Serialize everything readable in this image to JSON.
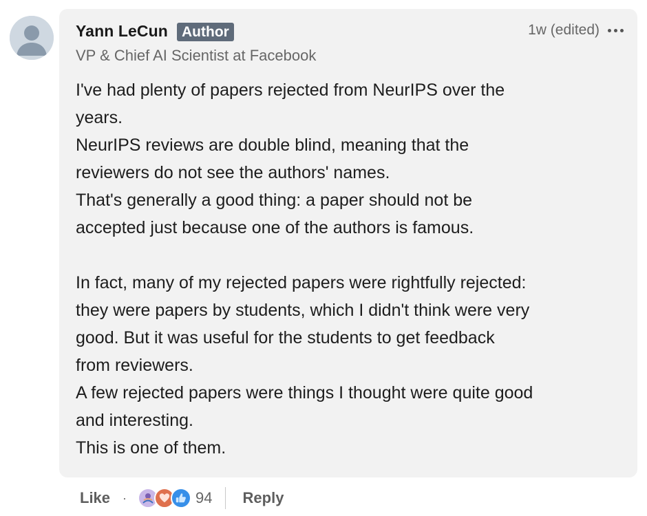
{
  "comment": {
    "author": {
      "name": "Yann LeCun",
      "badge": "Author",
      "headline": "VP & Chief AI Scientist at Facebook"
    },
    "timestamp": "1w",
    "edited_label": "(edited)",
    "more_icon": "more-horizontal-icon",
    "body_lines": [
      "I've had plenty of papers rejected from NeurIPS over the",
      "years.",
      "NeurIPS reviews are double blind, meaning that the",
      "reviewers do not see the authors' names.",
      "That's generally a good thing: a paper should not be",
      "accepted just because one of the authors is famous.",
      "",
      "In fact, many of my rejected papers were rightfully rejected:",
      "they were papers by students, which I didn't think were very",
      "good. But it was useful for the students to get feedback",
      "from reviewers.",
      "A few rejected papers were things I thought were quite good",
      "and interesting.",
      "This is one of them."
    ]
  },
  "actions": {
    "like_label": "Like",
    "separator": "·",
    "reactions": [
      {
        "icon": "insightful-reaction-icon",
        "color": "#c9b7e8"
      },
      {
        "icon": "love-reaction-icon",
        "color": "#df704d"
      },
      {
        "icon": "like-reaction-icon",
        "color": "#378fe9"
      }
    ],
    "reaction_count": "94",
    "reply_label": "Reply"
  }
}
